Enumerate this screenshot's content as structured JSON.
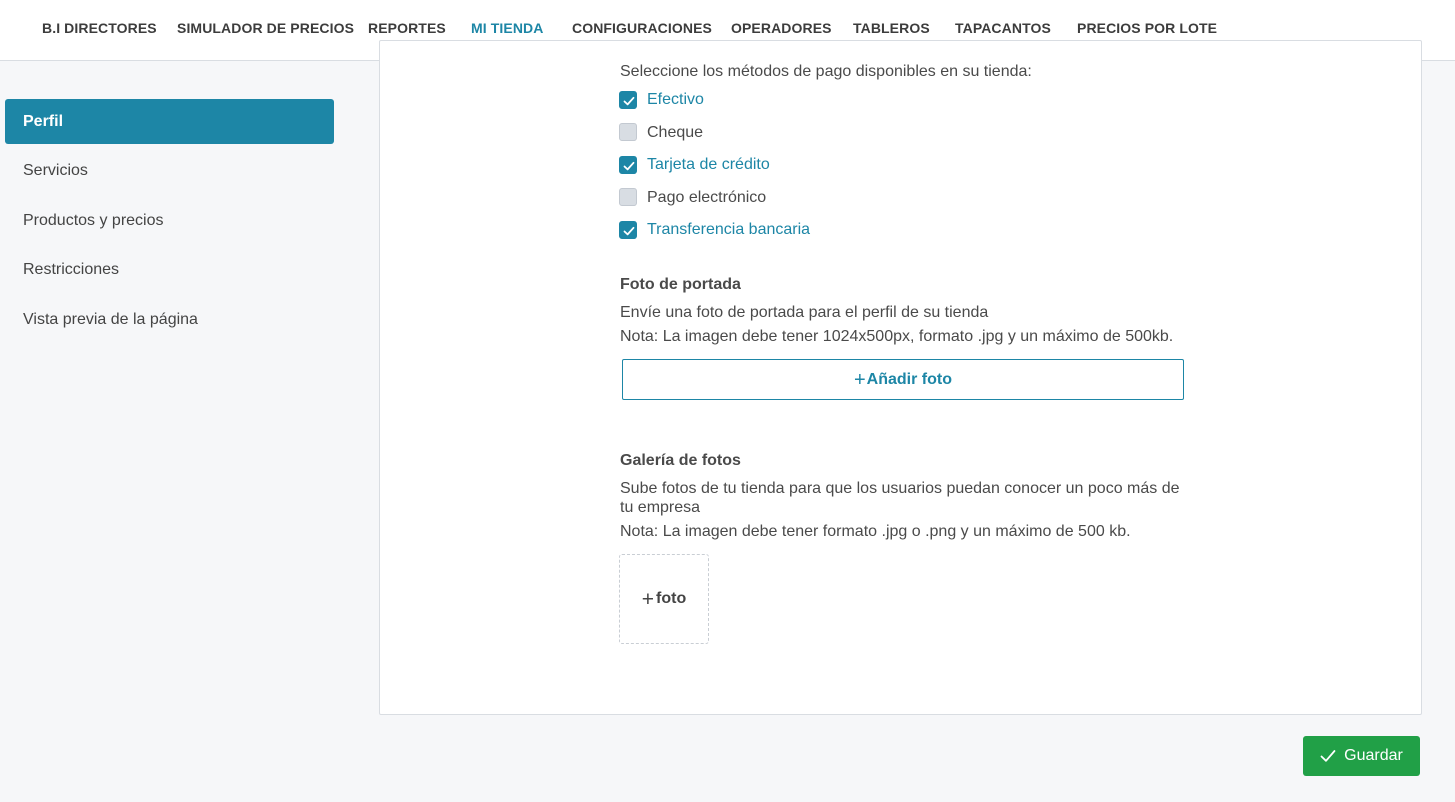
{
  "nav": {
    "tabs": [
      {
        "label": "B.I DIRECTORES"
      },
      {
        "label": "SIMULADOR DE PRECIOS"
      },
      {
        "label": "REPORTES"
      },
      {
        "label": "MI TIENDA"
      },
      {
        "label": "CONFIGURACIONES"
      },
      {
        "label": "OPERADORES"
      },
      {
        "label": "TABLEROS"
      },
      {
        "label": "TAPACANTOS"
      },
      {
        "label": "PRECIOS POR LOTE"
      }
    ],
    "active_tab": "MI TIENDA"
  },
  "sidebar": {
    "items": [
      {
        "label": "Perfil",
        "active": true
      },
      {
        "label": "Servicios"
      },
      {
        "label": "Productos y precios"
      },
      {
        "label": "Restricciones"
      },
      {
        "label": "Vista previa de la página"
      }
    ]
  },
  "payment": {
    "prompt": "Seleccione los métodos de pago disponibles en su tienda:",
    "methods": [
      {
        "label": "Efectivo",
        "checked": true
      },
      {
        "label": "Cheque",
        "checked": false
      },
      {
        "label": "Tarjeta de crédito",
        "checked": true
      },
      {
        "label": "Pago electrónico",
        "checked": false
      },
      {
        "label": "Transferencia bancaria",
        "checked": true
      }
    ]
  },
  "cover_photo": {
    "heading": "Foto de portada",
    "description": "Envíe una foto de portada para el perfil de su tienda",
    "note": "Nota: La imagen debe tener 1024x500px, formato .jpg y un máximo de 500kb.",
    "button_plus": "+",
    "button_label": "Añadir foto"
  },
  "gallery": {
    "heading": "Galería de fotos",
    "description_line1": "Sube fotos de tu tienda para que los usuarios puedan conocer un poco más de",
    "description_line2": "tu empresa",
    "note": "Nota: La imagen debe tener formato .jpg o .png y un máximo de 500 kb.",
    "add_plus": "+",
    "add_label": "foto"
  },
  "save_button": {
    "label": "Guardar"
  },
  "colors": {
    "accent": "#1d86a6",
    "save_green": "#21a047",
    "background": "#f6f7f9"
  }
}
